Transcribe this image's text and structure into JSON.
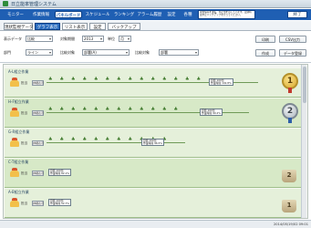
{
  "app": {
    "title": "日立能率管理システム",
    "exit_label": "終了"
  },
  "menu": {
    "items": [
      {
        "label": "モニター"
      },
      {
        "label": "作業情報"
      },
      {
        "label": "パネルボード"
      },
      {
        "label": "スケジュール"
      },
      {
        "label": "ランキング"
      },
      {
        "label": "アラーム履歴"
      },
      {
        "label": "設定"
      },
      {
        "label": "各種"
      }
    ],
    "backup_label": "バックアップ",
    "notice": "現在保存を運転、停止中を示しています。定期時は中止バックアップを行ってください。"
  },
  "tabs": [
    "現状監視データ",
    "グラフ表示",
    "リスト表示",
    "設定"
  ],
  "filters": {
    "display_label": "表示データ",
    "display_value": "比較",
    "period_label": "対象期間",
    "period_value": "2013",
    "unit_label": "単位",
    "unit_value": "月",
    "group_label": "部門",
    "group_value": "ライン",
    "compare_label": "比較対象",
    "compare_value": "部署(A)",
    "compare2_label": "比較対象",
    "compare2_value": "部署",
    "btn_print": "印刷",
    "btn_csv": "CSV出力",
    "btn_create": "作成",
    "btn_data": "データ登録"
  },
  "rows": [
    {
      "team": "A-L組立作業",
      "member": "担当",
      "detail": "詳細表示",
      "runners": 14,
      "stat_line1": "目標 100台",
      "stat_line2": "作業時間 102.8%",
      "rank": "1",
      "rank_style": "gold"
    },
    {
      "team": "H-F組立作業",
      "member": "担当",
      "detail": "詳細表示",
      "runners": 12,
      "stat_line1": "目標 100台",
      "stat_line2": "作業時間 99.2%",
      "rank": "2",
      "rank_style": "silver"
    },
    {
      "team": "G-R組立作業",
      "member": "担当",
      "detail": "詳細表示",
      "runners": 11,
      "stat_line1": "目標 100台",
      "stat_line2": "作業時間 96.5%",
      "rank": "",
      "rank_style": ""
    },
    {
      "team": "C-T組立作業",
      "member": "担当",
      "detail": "詳細表示",
      "runners": 0,
      "stat_line1": "目標 100台",
      "stat_line2": "作業時間 62.1%",
      "rank": "2",
      "rank_style": "trophy"
    },
    {
      "team": "A-B組立作業",
      "member": "担当",
      "detail": "詳細表示",
      "runners": 0,
      "stat_line1": "目標 100台",
      "stat_line2": "作業時間 52.7%",
      "rank": "1",
      "rank_style": "trophy"
    }
  ],
  "status": {
    "timestamp": "2014/05/19/02 09:01"
  },
  "colors": {
    "menu_bg": "#1f5fb3",
    "row_bg": "#d7e9c7",
    "runner": "#3f7a2c"
  }
}
